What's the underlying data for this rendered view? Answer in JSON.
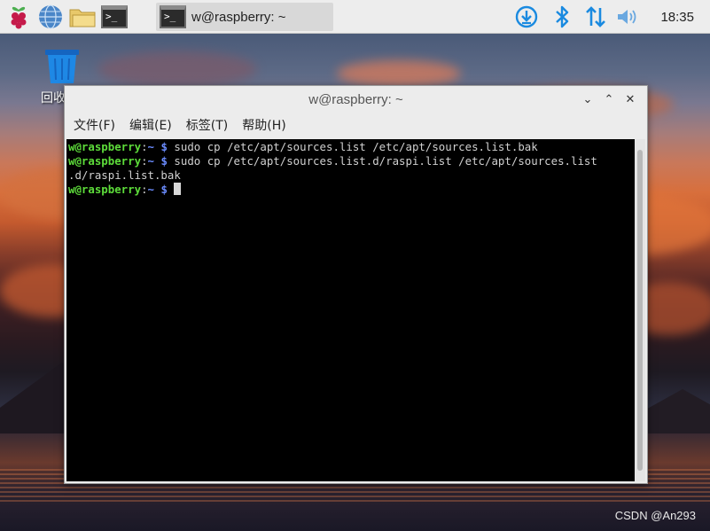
{
  "taskbar": {
    "task_label": "w@raspberry: ~",
    "clock": "18:35",
    "icons": [
      "raspberry-menu-icon",
      "web-browser-icon",
      "file-manager-icon",
      "terminal-icon"
    ],
    "tray_icons": [
      "update-download-icon",
      "bluetooth-icon",
      "network-transfer-icon",
      "volume-icon"
    ]
  },
  "desktop": {
    "trash_label": "回收"
  },
  "window": {
    "title": "w@raspberry: ~",
    "menu": [
      "文件(F)",
      "编辑(E)",
      "标签(T)",
      "帮助(H)"
    ],
    "controls": [
      "minimize",
      "maximize",
      "close"
    ]
  },
  "terminal": {
    "lines": [
      {
        "user": "w@raspberry",
        "path": "~",
        "command": "sudo cp /etc/apt/sources.list /etc/apt/sources.list.bak"
      },
      {
        "user": "w@raspberry",
        "path": "~",
        "command": "sudo cp /etc/apt/sources.list.d/raspi.list /etc/apt/sources.list",
        "continuation": ".d/raspi.list.bak"
      },
      {
        "user": "w@raspberry",
        "path": "~",
        "command": ""
      }
    ]
  },
  "watermark": "CSDN @An293",
  "colors": {
    "prompt_user": "#5ddc3a",
    "prompt_path": "#6b8cff",
    "terminal_bg": "#000000",
    "taskbar_bg": "#ededed"
  }
}
